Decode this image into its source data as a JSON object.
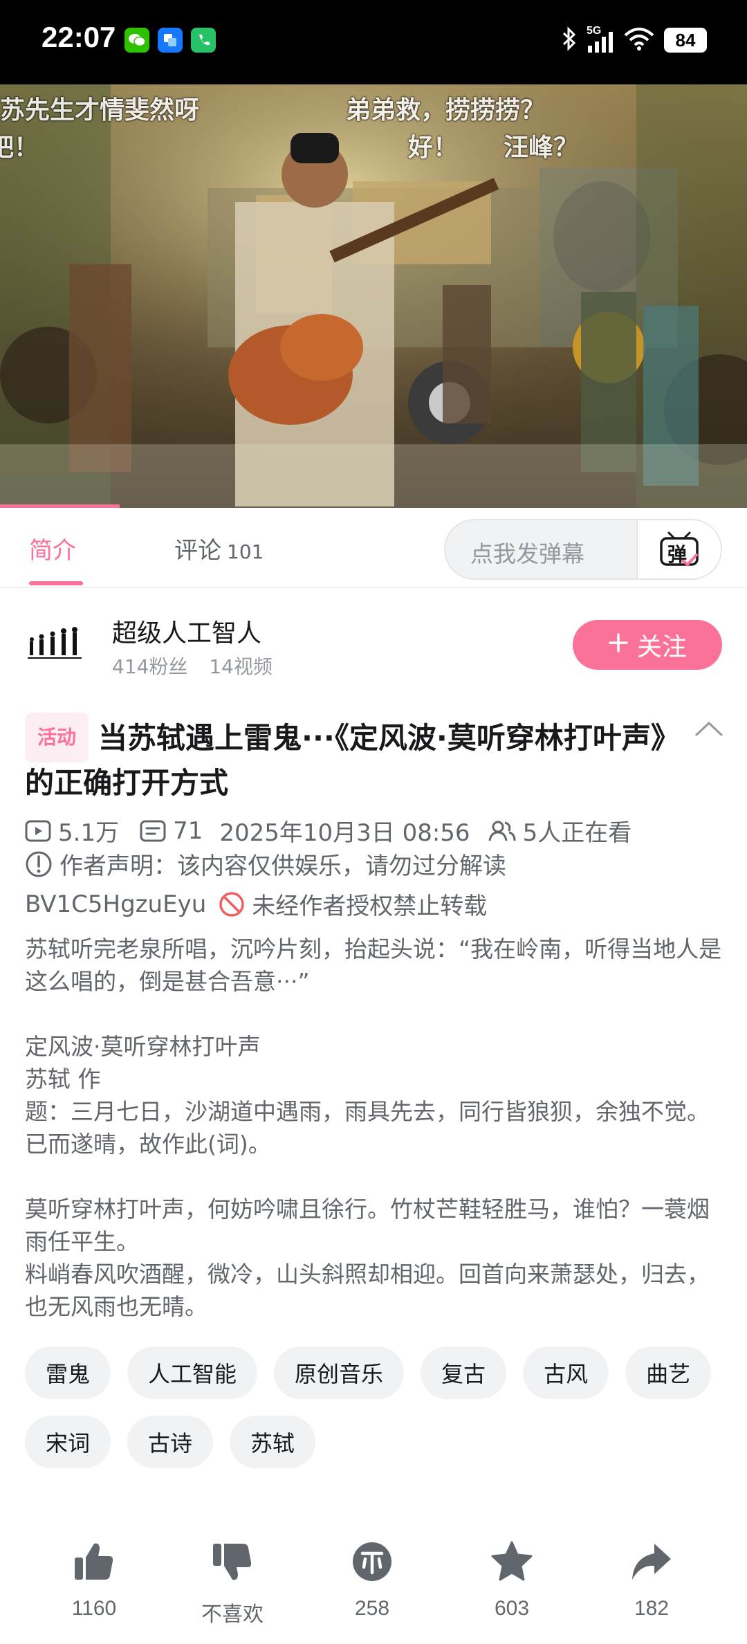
{
  "status_bar": {
    "time": "22:07",
    "network": "5G",
    "battery": "84",
    "app_icons": [
      "wechat-icon",
      "app-icon",
      "phone-app-icon"
    ]
  },
  "video": {
    "danmaku": [
      "苏先生才情斐然呀",
      "弟弟救，捞捞捞？",
      "好！",
      "汪峰？",
      "吧！"
    ],
    "progress": 0.16
  },
  "tabs": {
    "intro_label": "简介",
    "comments_label": "评论",
    "comments_count": "101",
    "danmu_placeholder": "点我发弹幕",
    "danmu_button_label": "弹"
  },
  "author": {
    "name": "超级人工智人",
    "fans": "414粉丝",
    "videos": "14视频",
    "follow_label": "关注"
  },
  "video_info": {
    "badge": "活动",
    "title": "当苏轼遇上雷鬼···《定风波·莫听穿林打叶声》的正确打开方式",
    "views": "5.1万",
    "danmaku_count": "71",
    "date": "2025年10月3日 08:56",
    "watching": "5人正在看",
    "declaration": "作者声明：该内容仅供娱乐，请勿过分解读",
    "bvid": "BV1C5HgzuEyu",
    "repost_notice": "未经作者授权禁止转载",
    "description": "苏轼听完老泉所唱，沉吟片刻，抬起头说：“我在岭南，听得当地人是这么唱的，倒是甚合吾意···”\n\n定风波·莫听穿林打叶声\n苏轼 作\n题：三月七日，沙湖道中遇雨，雨具先去，同行皆狼狈，余独不觉。已而遂晴，故作此(词)。\n\n莫听穿林打叶声，何妨吟啸且徐行。竹杖芒鞋轻胜马，谁怕？一蓑烟雨任平生。\n料峭春风吹酒醒，微冷，山头斜照却相迎。回首向来萧瑟处，归去，也无风雨也无晴。"
  },
  "tags": [
    "雷鬼",
    "人工智能",
    "原创音乐",
    "复古",
    "古风",
    "曲艺",
    "宋词",
    "古诗",
    "苏轼"
  ],
  "actions": {
    "like": "1160",
    "dislike": "不喜欢",
    "coin": "258",
    "favorite": "603",
    "share": "182"
  },
  "colors": {
    "accent": "#fb7299",
    "text_secondary": "#61666d",
    "icon_gray": "#61666d"
  }
}
